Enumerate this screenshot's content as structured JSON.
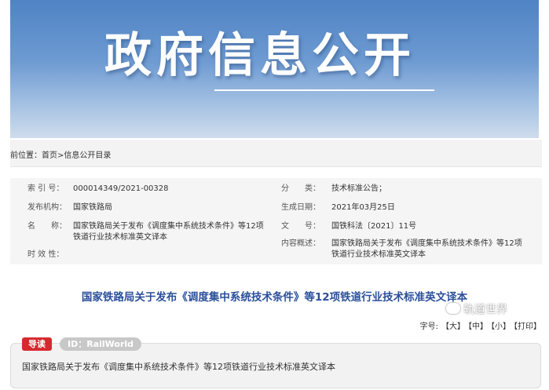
{
  "banner": {
    "title": "政府信息公开"
  },
  "breadcrumb": {
    "prefix": "前位置：",
    "home": "首页",
    "sep": ">",
    "current": "信息公开目录"
  },
  "meta": {
    "index_label": "索 引 号：",
    "index_value": "000014349/2021-00328",
    "category_label": "分　　类：",
    "category_value": "技术标准公告；",
    "publisher_label": "发布机构：",
    "publisher_value": "国家铁路局",
    "date_label": "生成日期：",
    "date_value": "2021年03月25日",
    "name_label": "名　　称：",
    "name_value_line1": "国家铁路局关于发布《调度集中系统技术条件》等12项",
    "name_value_line2": "铁道行业技术标准英文译本",
    "docno_label": "文　　号：",
    "docno_value": "国铁科法〔2021〕11号",
    "summary_label": "内容概述：",
    "summary_value_line1": "国家铁路局关于发布《调度集中系统技术条件》等12项",
    "summary_value_line2": "铁道行业技术标准英文译本",
    "validity_label": "时 效 性："
  },
  "article": {
    "title": "国家铁路局关于发布《调度集中系统技术条件》等12项铁道行业技术标准英文译本"
  },
  "font_size": {
    "label": "字号:",
    "large": "【大】",
    "medium": "【中】",
    "small": "【小】",
    "print": "【打印】"
  },
  "guide": {
    "tag": "导读",
    "id_tag": "ID：RailWorld",
    "text": "国家铁路局关于发布《调度集中系统技术条件》等12项铁道行业技术标准英文译本"
  },
  "watermark": {
    "text": "轨道世界",
    "icon": "wechat-icon"
  }
}
